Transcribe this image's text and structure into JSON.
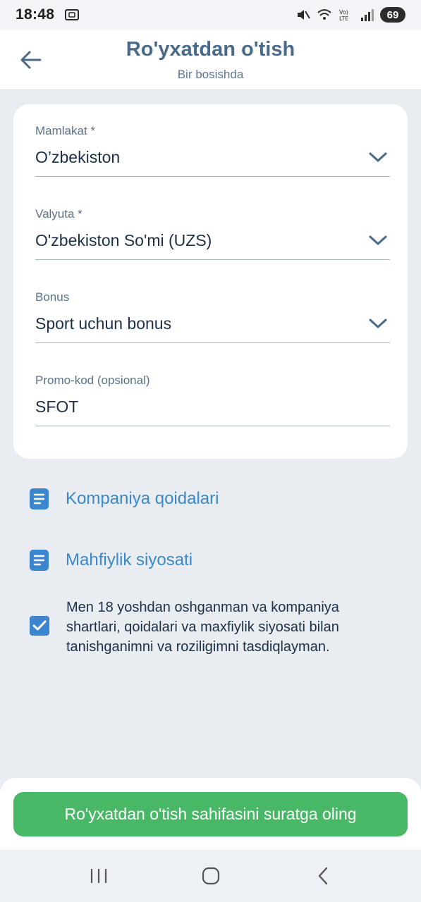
{
  "status_bar": {
    "time": "18:48",
    "battery": "69",
    "icons": [
      "screenshot-icon",
      "mute-icon",
      "wifi-icon",
      "volte-icon",
      "signal-icon"
    ]
  },
  "header": {
    "title": "Ro'yxatdan o'tish",
    "subtitle": "Bir bosishda"
  },
  "form": {
    "country": {
      "label": "Mamlakat *",
      "value": "O’zbekiston"
    },
    "currency": {
      "label": "Valyuta *",
      "value": "O'zbekiston So'mi (UZS)"
    },
    "bonus": {
      "label": "Bonus",
      "value": "Sport uchun bonus"
    },
    "promo": {
      "label": "Promo-kod (opsional)",
      "value": "SFOT"
    }
  },
  "links": {
    "rules": "Kompaniya qoidalari",
    "privacy": "Mahfiylik siyosati"
  },
  "consent": {
    "checked": true,
    "text": "Men 18 yoshdan oshganman va kompaniya shartlari, qoidalari va maxfiylik siyosati bilan tanishganimni va roziligimni tasdiqlayman."
  },
  "action": {
    "button_label": "Ro'yxatdan o'tish sahifasini suratga oling"
  },
  "colors": {
    "accent": "#3a88c8",
    "button": "#48b866",
    "title": "#4a6a8a",
    "background": "#e9edf2"
  }
}
